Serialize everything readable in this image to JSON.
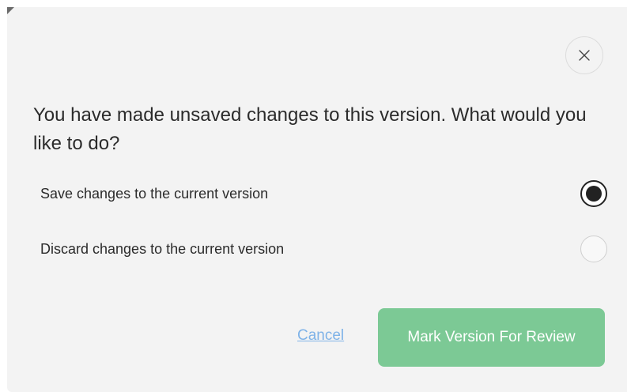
{
  "dialog": {
    "question": "You have made unsaved changes to this version. What would you like to do?",
    "close_icon": "close-icon",
    "options": [
      {
        "label": "Save changes to the current version",
        "selected": true
      },
      {
        "label": "Discard changes to the current version",
        "selected": false
      }
    ],
    "cancel_label": "Cancel",
    "primary_label": "Mark Version For Review"
  },
  "colors": {
    "dialog_background": "#f3f3f3",
    "primary_button": "#7cc995",
    "link": "#7fb3e8",
    "text": "#2b2b2b"
  }
}
